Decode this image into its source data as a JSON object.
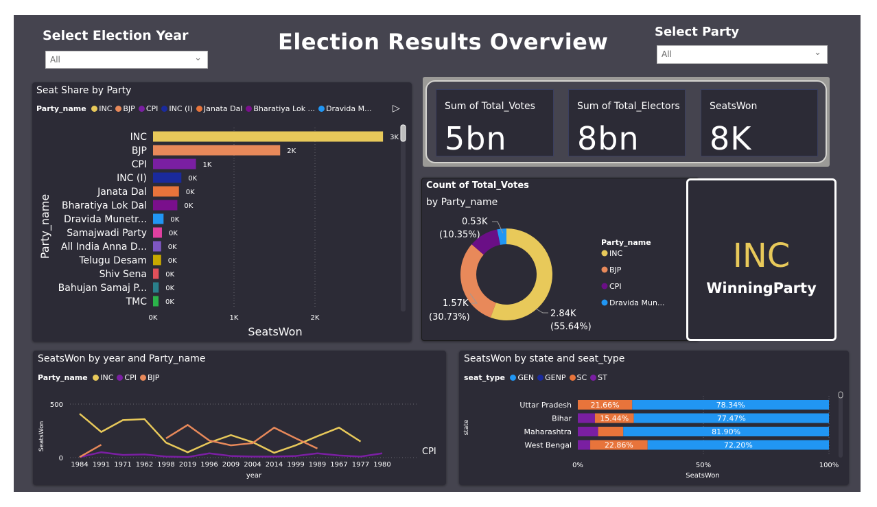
{
  "title": "Election Results Overview",
  "year_slicer": {
    "label": "Select Election Year",
    "value": "All"
  },
  "party_slicer": {
    "label": "Select Party",
    "value": "All"
  },
  "seat_share": {
    "title": "Seat Share by Party",
    "legend_label": "Party_name",
    "legend": [
      {
        "name": "INC",
        "color": "#e8c95a"
      },
      {
        "name": "BJP",
        "color": "#e8895a"
      },
      {
        "name": "CPI",
        "color": "#7a1fa2"
      },
      {
        "name": "INC (I)",
        "color": "#1a2a9c"
      },
      {
        "name": "Janata Dal",
        "color": "#e8743b"
      },
      {
        "name": "Bharatiya Lok ...",
        "color": "#7a0f8c"
      },
      {
        "name": "Dravida M...",
        "color": "#2196f3"
      }
    ],
    "ylabel": "Party_name",
    "xlabel": "SeatsWon"
  },
  "kpis": {
    "votes": {
      "label": "Sum of Total_Votes",
      "value": "5bn"
    },
    "electors": {
      "label": "Sum of Total_Electors",
      "value": "8bn"
    },
    "seats": {
      "label": "SeatsWon",
      "value": "8K"
    }
  },
  "donut": {
    "title": "Count of Total_Votes",
    "subtitle": "by Party_name",
    "legend_label": "Party_name",
    "legend": [
      {
        "name": "INC",
        "color": "#e8c95a"
      },
      {
        "name": "BJP",
        "color": "#e8895a"
      },
      {
        "name": "CPI",
        "color": "#6a0f86"
      },
      {
        "name": "Dravida Mun...",
        "color": "#2196f3"
      }
    ],
    "labels": {
      "inc_value": "2.84K",
      "inc_pct": "(55.64%)",
      "bjp_value": "1.57K",
      "bjp_pct": "(30.73%)",
      "cpi_value": "0.53K",
      "cpi_pct": "(10.35%)"
    }
  },
  "winner": {
    "party": "INC",
    "label": "WinningParty"
  },
  "line_panel": {
    "title": "SeatsWon by year and Party_name",
    "legend_label": "Party_name",
    "legend": [
      {
        "name": "INC",
        "color": "#e8c95a"
      },
      {
        "name": "CPI",
        "color": "#7a1fa2"
      },
      {
        "name": "BJP",
        "color": "#e8895a"
      }
    ],
    "ylabel": "SeatsWon",
    "xlabel": "year",
    "end_label": "CPI"
  },
  "stack_panel": {
    "title": "SeatsWon by state and seat_type",
    "legend_label": "seat_type",
    "legend": [
      {
        "name": "GEN",
        "color": "#2196f3"
      },
      {
        "name": "GENP",
        "color": "#1a2a9c"
      },
      {
        "name": "SC",
        "color": "#e8743b"
      },
      {
        "name": "ST",
        "color": "#7a1fa2"
      }
    ],
    "ylabel": "state",
    "xlabel": "SeatsWon"
  },
  "chart_data": [
    {
      "type": "bar",
      "orientation": "horizontal",
      "title": "Seat Share by Party",
      "categories": [
        "INC",
        "BJP",
        "CPI",
        "INC (I)",
        "Janata Dal",
        "Bharatiya Lok Dal",
        "Dravida Munetr...",
        "Samajwadi Party",
        "All India Anna D...",
        "Telugu Desam",
        "Shiv Sena",
        "Bahujan Samaj P...",
        "TMC"
      ],
      "values": [
        2840,
        1570,
        530,
        350,
        320,
        300,
        130,
        110,
        100,
        100,
        70,
        70,
        60
      ],
      "data_labels": [
        "3K",
        "2K",
        "1K",
        "0K",
        "0K",
        "0K",
        "0K",
        "0K",
        "0K",
        "0K",
        "0K",
        "0K",
        "0K"
      ],
      "colors": [
        "#e8c95a",
        "#e8895a",
        "#7a1fa2",
        "#1a2a9c",
        "#e8743b",
        "#7a0f8c",
        "#2196f3",
        "#e040a0",
        "#7e57c2",
        "#c9a800",
        "#e0505a",
        "#2a7f8a",
        "#2bb34a"
      ],
      "xticks": [
        "0K",
        "1K",
        "2K"
      ],
      "xlim": [
        0,
        3000
      ],
      "xlabel": "SeatsWon",
      "ylabel": "Party_name",
      "grid": true
    },
    {
      "type": "pie",
      "variant": "donut",
      "title": "Count of Total_Votes",
      "subtitle": "by Party_name",
      "slices": [
        {
          "name": "INC",
          "value": 2840,
          "percent": 55.64,
          "color": "#e8c95a"
        },
        {
          "name": "BJP",
          "value": 1570,
          "percent": 30.73,
          "color": "#e8895a"
        },
        {
          "name": "CPI",
          "value": 530,
          "percent": 10.35,
          "color": "#6a0f86"
        },
        {
          "name": "Dravida Mun...",
          "value": 167,
          "percent": 3.28,
          "color": "#2196f3"
        }
      ]
    },
    {
      "type": "line",
      "title": "SeatsWon by year and Party_name",
      "x": [
        "1984",
        "1991",
        "1971",
        "1962",
        "1998",
        "2019",
        "1996",
        "2009",
        "2004",
        "2014",
        "1999",
        "1989",
        "1967",
        "1977",
        "1980"
      ],
      "series": [
        {
          "name": "INC",
          "color": "#e8c95a",
          "values": [
            410,
            240,
            350,
            360,
            140,
            50,
            140,
            210,
            145,
            45,
            115,
            200,
            280,
            150,
            null
          ]
        },
        {
          "name": "CPI",
          "color": "#7a1fa2",
          "values": [
            5,
            50,
            25,
            30,
            10,
            5,
            40,
            15,
            10,
            10,
            15,
            40,
            20,
            10,
            40
          ]
        },
        {
          "name": "BJP",
          "color": "#e8895a",
          "values": [
            5,
            120,
            null,
            null,
            180,
            305,
            160,
            115,
            135,
            280,
            180,
            85,
            null,
            null,
            null
          ]
        }
      ],
      "yticks": [
        0,
        500
      ],
      "ylim": [
        0,
        550
      ],
      "xlabel": "year",
      "ylabel": "SeatsWon",
      "grid": true
    },
    {
      "type": "bar",
      "orientation": "horizontal",
      "stacked": "percent",
      "title": "SeatsWon by state and seat_type",
      "categories": [
        "Uttar Pradesh",
        "Bihar",
        "Maharashtra",
        "West Bengal"
      ],
      "series": [
        {
          "name": "ST",
          "color": "#7a1fa2",
          "values": [
            0,
            6.8,
            8.1,
            4.94
          ],
          "labels": [
            "",
            "",
            "",
            ""
          ]
        },
        {
          "name": "SC",
          "color": "#e8743b",
          "values": [
            21.66,
            15.44,
            10.0,
            22.86
          ],
          "labels": [
            "21.66%",
            "15.44%",
            "",
            "22.86%"
          ]
        },
        {
          "name": "GEN",
          "color": "#2196f3",
          "values": [
            78.34,
            77.47,
            81.9,
            72.2
          ],
          "labels": [
            "78.34%",
            "77.47%",
            "81.90%",
            "72.20%"
          ]
        }
      ],
      "xticks": [
        "0%",
        "50%",
        "100%"
      ],
      "xlabel": "SeatsWon",
      "ylabel": "state"
    }
  ]
}
